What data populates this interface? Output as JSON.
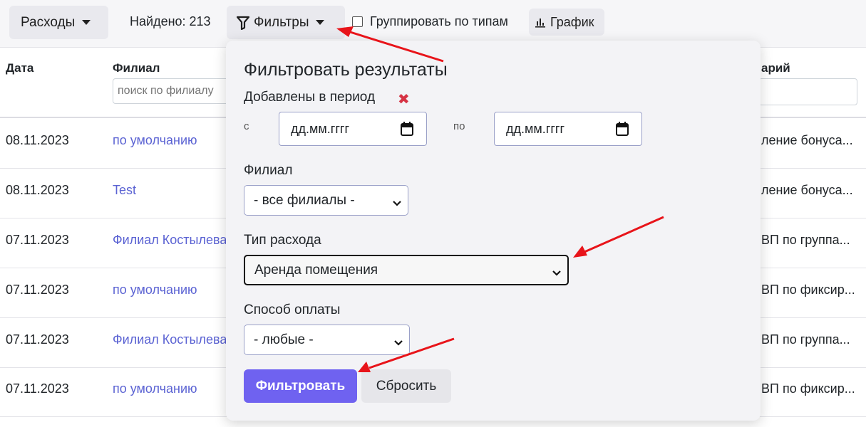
{
  "toolbar": {
    "expenses_label": "Расходы",
    "found_text": "Найдено: 213",
    "filters_label": "Фильтры",
    "group_label": "Группировать по типам",
    "chart_label": "График"
  },
  "table": {
    "headers": {
      "date": "Дата",
      "branch": "Филиал",
      "comment": "арий"
    },
    "branch_search_placeholder": "поиск по филиалу",
    "rows": [
      {
        "date": "08.11.2023",
        "branch": "по умолчанию",
        "comment": "ление бонуса..."
      },
      {
        "date": "08.11.2023",
        "branch": "Test",
        "comment": "ление бонуса..."
      },
      {
        "date": "07.11.2023",
        "branch": "Филиал Костылева",
        "comment": "ВП по группа..."
      },
      {
        "date": "07.11.2023",
        "branch": "по умолчанию",
        "comment": "ВП по фиксир..."
      },
      {
        "date": "07.11.2023",
        "branch": "Филиал Костылева",
        "comment": "ВП по группа..."
      },
      {
        "date": "07.11.2023",
        "branch": "по умолчанию",
        "comment": "ВП по фиксир..."
      }
    ]
  },
  "filters": {
    "title": "Фильтровать результаты",
    "period_label": "Добавлены в период",
    "remove_symbol": "✖",
    "from_label": "с",
    "to_label": "по",
    "date_from": "дд.мм.гггг",
    "date_to": "дд.мм.гггг",
    "branch_label": "Филиал",
    "branch_value": "- все филиалы -",
    "type_label": "Тип расхода",
    "type_value": "Аренда помещения",
    "payment_label": "Способ оплаты",
    "payment_value": "- любые -",
    "apply_label": "Фильтровать",
    "reset_label": "Сбросить"
  },
  "colors": {
    "accent": "#6f62f0",
    "link": "#5b63d3",
    "danger": "#d63344",
    "annotation": "#e8141a"
  }
}
